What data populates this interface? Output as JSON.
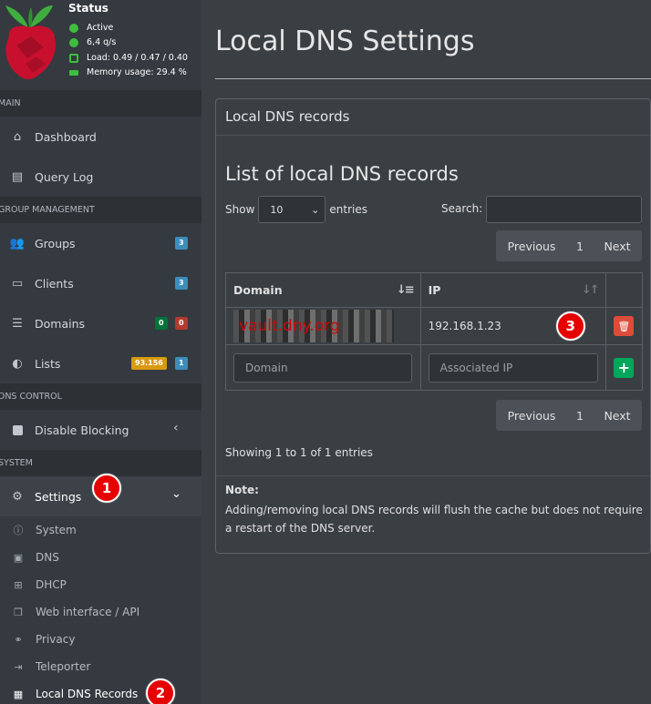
{
  "status": {
    "title": "Status",
    "active": "Active",
    "qps": "6,4 q/s",
    "load": "Load: 0.49 / 0.47 / 0.40",
    "memory": "Memory usage: 29.4 %"
  },
  "sidebar": {
    "sections": {
      "main": "MAIN",
      "group_management": "GROUP MANAGEMENT",
      "dns_control": "DNS CONTROL",
      "system": "SYSTEM"
    },
    "items": {
      "dashboard": "Dashboard",
      "query_log": "Query Log",
      "groups": "Groups",
      "clients": "Clients",
      "domains": "Domains",
      "lists": "Lists",
      "disable_blocking": "Disable Blocking",
      "settings": "Settings"
    },
    "badges": {
      "groups": "3",
      "clients": "3",
      "domains_allow": "0",
      "domains_deny": "0",
      "lists_domains": "93.156",
      "lists_count": "1"
    },
    "settings_sub": {
      "system": "System",
      "dns": "DNS",
      "dhcp": "DHCP",
      "web_api": "Web interface / API",
      "privacy": "Privacy",
      "teleporter": "Teleporter",
      "local_dns": "Local DNS Records"
    },
    "markers": {
      "one": "1",
      "two": "2"
    }
  },
  "main": {
    "page_title": "Local DNS Settings",
    "card_title": "Local DNS records",
    "list_title": "List of local DNS records",
    "show_label": "Show",
    "show_value": "10",
    "entries_label": "entries",
    "search_label": "Search:",
    "pager": {
      "previous": "Previous",
      "page": "1",
      "next": "Next"
    },
    "table": {
      "col_domain": "Domain",
      "col_ip": "IP",
      "row_domain_watermark": "vault.dny.org",
      "row_ip": "192.168.1.23",
      "marker_three": "3",
      "domain_placeholder": "Domain",
      "ip_placeholder": "Associated IP"
    },
    "info": "Showing 1 to 1 of 1 entries",
    "note_title": "Note:",
    "note_text": "Adding/removing local DNS records will flush the cache but does not require a restart of the DNS server."
  },
  "colors": {
    "sidebar_bg": "#343a40",
    "content_bg": "#3a3f44",
    "marker_red": "#e60000",
    "badge_blue": "#3c8dbc",
    "badge_green": "#00733a",
    "badge_red": "#b23a2e",
    "badge_orange": "#d89a10",
    "delete_red": "#dd4b39",
    "add_green": "#00a65a"
  },
  "icons": [
    "raspberry-pi-logo",
    "home-icon",
    "file-icon",
    "users-icon",
    "laptop-icon",
    "list-icon",
    "shield-icon",
    "stop-icon",
    "chevron-left-icon",
    "gears-icon",
    "chevron-down-icon",
    "info-icon",
    "server-icon",
    "sitemap-icon",
    "window-icon",
    "binoculars-icon",
    "export-icon",
    "address-card-icon",
    "sort-icon",
    "trash-icon",
    "plus-icon"
  ]
}
